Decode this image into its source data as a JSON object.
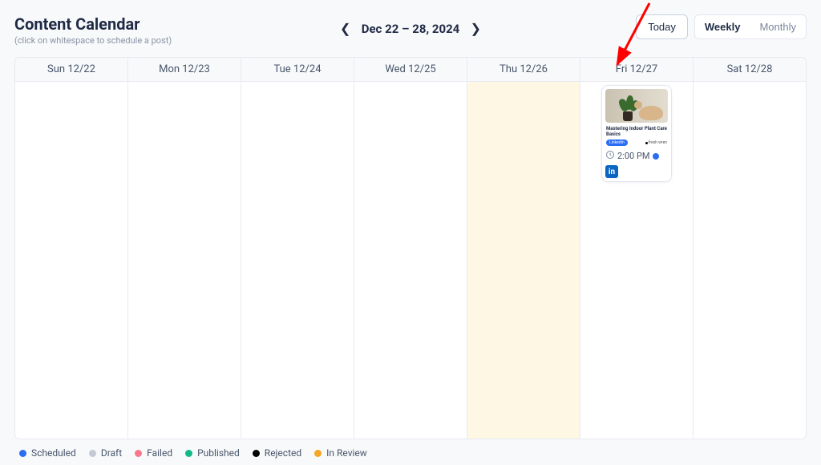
{
  "header": {
    "title": "Content Calendar",
    "subtitle": "(click on whitespace to schedule a post)",
    "date_range": "Dec 22 – 28, 2024"
  },
  "controls": {
    "today_label": "Today",
    "views": {
      "weekly": "Weekly",
      "monthly": "Monthly"
    }
  },
  "days": [
    {
      "label": "Sun 12/22",
      "today": false
    },
    {
      "label": "Mon 12/23",
      "today": false
    },
    {
      "label": "Tue 12/24",
      "today": false
    },
    {
      "label": "Wed 12/25",
      "today": false
    },
    {
      "label": "Thu 12/26",
      "today": true
    },
    {
      "label": "Fri 12/27",
      "today": false
    },
    {
      "label": "Sat 12/28",
      "today": false
    }
  ],
  "post": {
    "day_index": 5,
    "title": "Mastering Indoor Plant Care Basics",
    "time": "2:00 PM",
    "status": "scheduled",
    "platform": "linkedin",
    "platform_glyph": "in",
    "tag_label": "LinkedIn"
  },
  "legend": [
    {
      "label": "Scheduled",
      "color": "#2a6df4"
    },
    {
      "label": "Draft",
      "color": "#c4c9d4"
    },
    {
      "label": "Failed",
      "color": "#f87a8a"
    },
    {
      "label": "Published",
      "color": "#12b886"
    },
    {
      "label": "Rejected",
      "color": "#000000"
    },
    {
      "label": "In Review",
      "color": "#f5a623"
    }
  ],
  "icons": {
    "prev": "chevron-left-icon",
    "next": "chevron-right-icon",
    "clock": "clock-icon"
  }
}
